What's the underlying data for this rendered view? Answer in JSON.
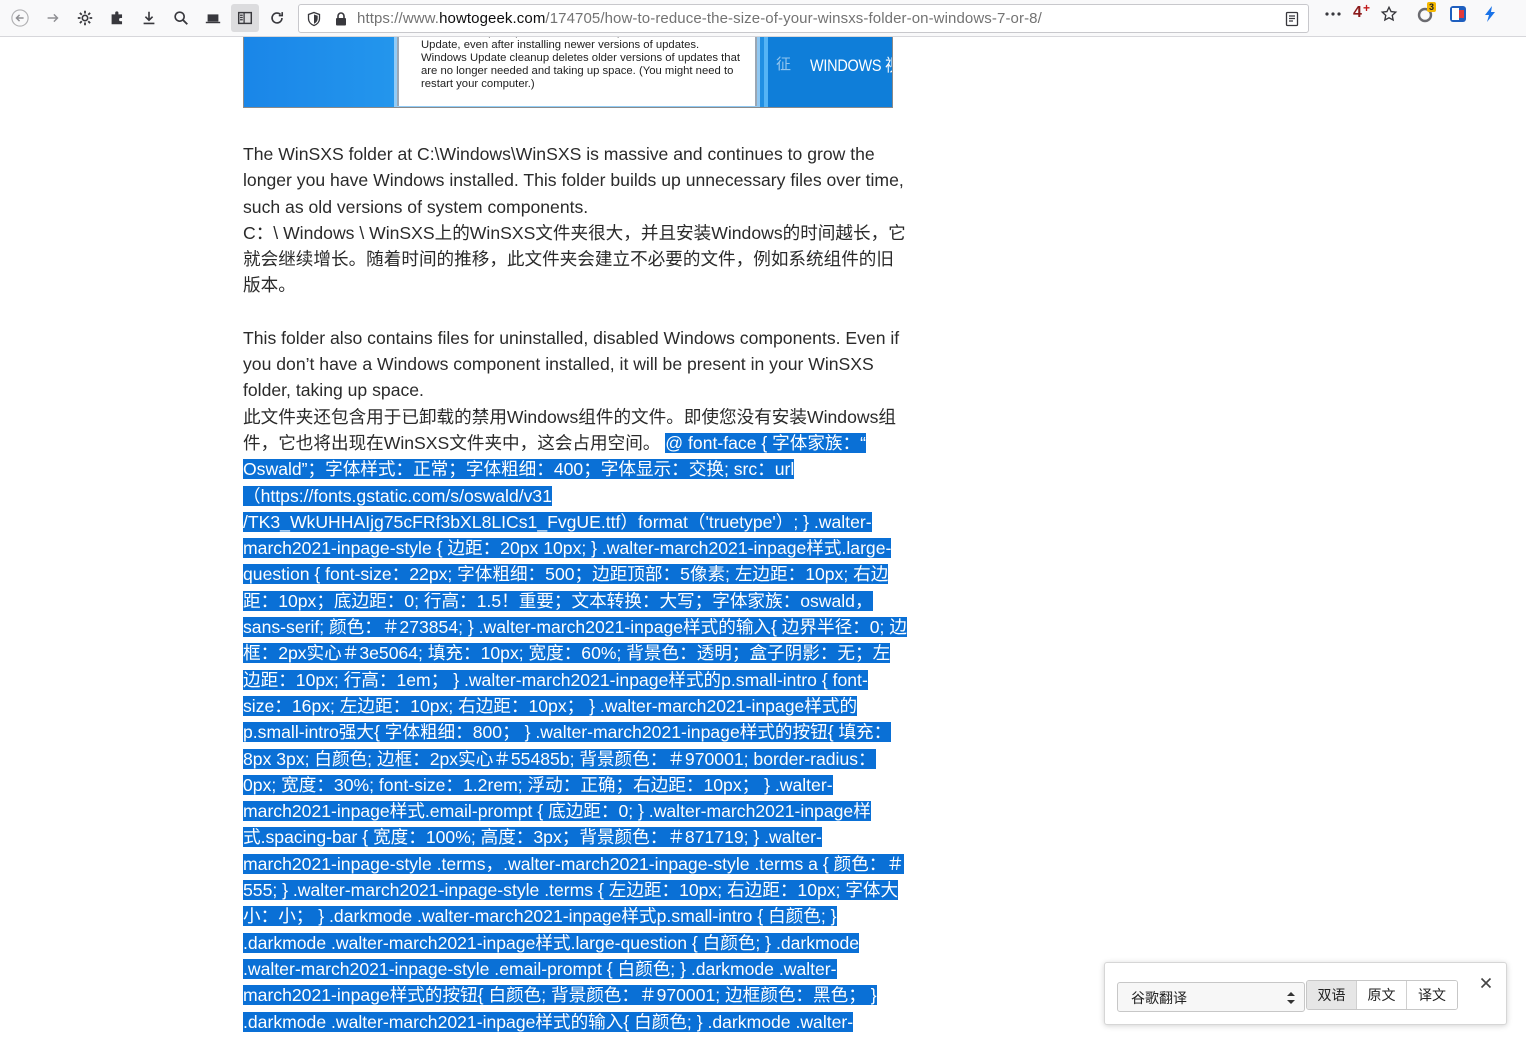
{
  "browser": {
    "url_prefix": "https://www.",
    "url_domain": "howtogeek.com",
    "url_path": "/174705/how-to-reduce-the-size-of-your-winsxs-folder-on-windows-7-or-8/",
    "badge_4": "4",
    "badge_plus": "+",
    "badge_3": "3"
  },
  "hero": {
    "caption": "Windows keeps copies of all installed updates from Windows Update, even after installing newer versions of updates. Windows Update cleanup deletes older versions of updates that are no longer needed and taking up space. (You might need to restart your computer.)",
    "ghost_label": "征",
    "label": "WINDOWS 视"
  },
  "article": {
    "p1_en": "The WinSXS folder at C:\\Windows\\WinSXS is massive and continues to grow the longer you have Windows installed. This folder builds up unnecessary files over time, such as old versions of system components.",
    "p1_zh": "C：\\ Windows \\ WinSXS上的WinSXS文件夹很大，并且安装Windows的时间越长，它就会继续增长。随着时间的推移，此文件夹会建立不必要的文件，例如系统组件的旧版本。",
    "p2_en": "This folder also contains files for uninstalled, disabled Windows components. Even if you don’t have a Windows component installed, it will be present in your WinSXS folder, taking up space.",
    "p2_zh": "此文件夹还包含用于已卸载的禁用Windows组件的文件。即使您没有安装Windows组件，它也将出现在WinSXS文件夹中，这会占用空间。",
    "selected": "@ font-face { 字体家族：“ Oswald”；字体样式：正常；字体粗细：400；字体显示：交换; src：url（https://fonts.gstatic.com/s/oswald/v31 /TK3_WkUHHAIjg75cFRf3bXL8LICs1_FvgUE.ttf）format（'truetype'）; } .walter-march2021-inpage-style { 边距：20px 10px; } .walter-march2021-inpage样式.large-question { font-size：22px; 字体粗细：500；边距顶部：5像素; 左边距：10px; 右边距：10px；底边距：0; 行高：1.5！重要；文本转换：大写；字体家族：oswald，sans-serif; 颜色：＃273854; } .walter-march2021-inpage样式的输入{ 边界半径：0; 边框：2px实心＃3e5064; 填充：10px; 宽度：60%; 背景色：透明；盒子阴影：无；左边距：10px; 行高：1em； } .walter-march2021-inpage样式的p.small-intro { font-size：16px; 左边距：10px; 右边距：10px； } .walter-march2021-inpage样式的p.small-intro强大{ 字体粗细：800； } .walter-march2021-inpage样式的按钮{ 填充：8px 3px; 白颜色; 边框：2px实心＃55485b; 背景颜色：＃970001; border-radius：0px; 宽度：30%; font-size：1.2rem; 浮动：正确；右边距：10px； } .walter-march2021-inpage样式.email-prompt { 底边距：0; } .walter-march2021-inpage样式.spacing-bar { 宽度：100%; 高度：3px；背景颜色：＃871719; } .walter-march2021-inpage-style .terms，.walter-march2021-inpage-style .terms a { 颜色：＃555; } .walter-march2021-inpage-style .terms { 左边距：10px; 右边距：10px; 字体大小：小； } .darkmode .walter-march2021-inpage样式p.small-intro { 白颜色; } .darkmode .walter-march2021-inpage样式.large-question { 白颜色; } .darkmode .walter-march2021-inpage-style .email-prompt { 白颜色; } .darkmode .walter-march2021-inpage样式的按钮{ 白颜色; 背景颜色：＃970001; 边框颜色：黑色； } .darkmode .walter-march2021-inpage样式的输入{ 白颜色; } .darkmode .walter-"
  },
  "translate_popup": {
    "engine": "谷歌翻译",
    "tabs": [
      "双语",
      "原文",
      "译文"
    ],
    "active_tab": "双语"
  },
  "colors": {
    "selection": "#0a70d6",
    "hero_blue": "#1a86e8"
  }
}
